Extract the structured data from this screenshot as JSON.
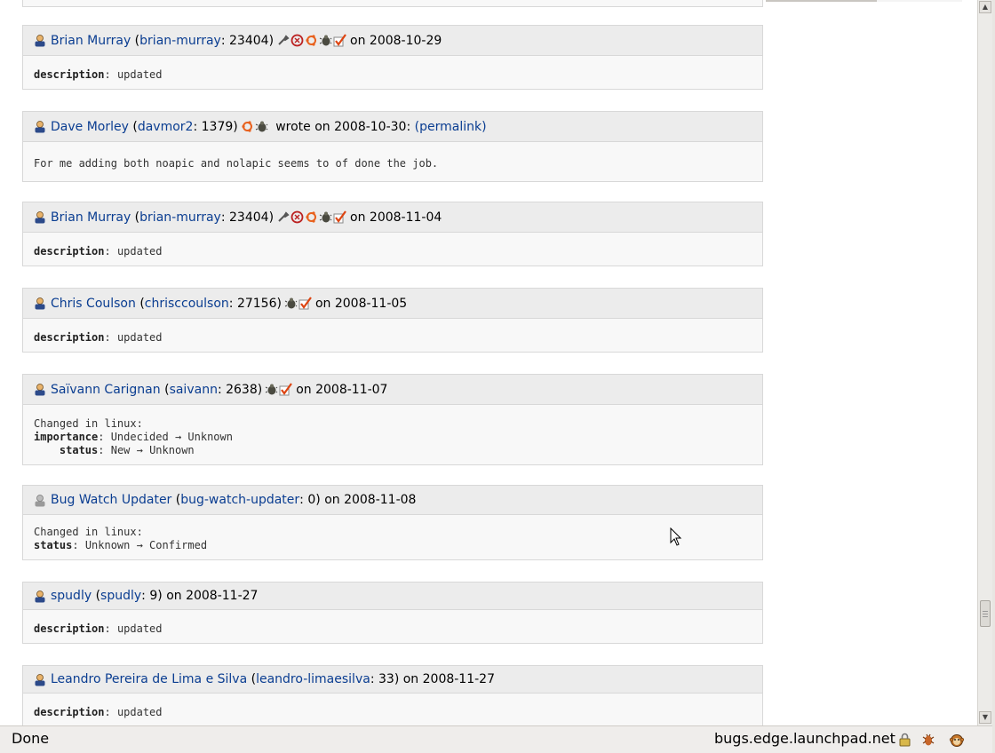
{
  "entries": [
    {
      "kind": "activity",
      "person": "Brian Murray",
      "username": "brian-murray",
      "karma": "23404",
      "badges": [
        "wrench",
        "ubuntu-red",
        "ubuntu-community",
        "bug",
        "check"
      ],
      "suffix": "on 2008-10-29",
      "body_lines": [
        {
          "key": "description",
          "value": "updated"
        }
      ]
    },
    {
      "kind": "comment",
      "person": "Dave Morley",
      "username": "davmor2",
      "karma": "1379",
      "badges": [
        "ubuntu-community",
        "bug"
      ],
      "suffix": "wrote on 2008-10-30:",
      "permalink": "(permalink)",
      "comment": "For me adding both noapic and nolapic seems to of done the job."
    },
    {
      "kind": "activity",
      "person": "Brian Murray",
      "username": "brian-murray",
      "karma": "23404",
      "badges": [
        "wrench",
        "ubuntu-red",
        "ubuntu-community",
        "bug",
        "check"
      ],
      "suffix": "on 2008-11-04",
      "body_lines": [
        {
          "key": "description",
          "value": "updated"
        }
      ]
    },
    {
      "kind": "activity",
      "person": "Chris Coulson",
      "username": "chrisccoulson",
      "karma": "27156",
      "badges": [
        "bug",
        "check"
      ],
      "suffix": "on 2008-11-05",
      "body_lines": [
        {
          "key": "description",
          "value": "updated"
        }
      ]
    },
    {
      "kind": "change",
      "person": "Saïvann Carignan",
      "username": "saivann",
      "karma": "2638",
      "badges": [
        "bug",
        "check"
      ],
      "suffix": "on 2008-11-07",
      "changed_in": "Changed in linux:",
      "body_lines": [
        {
          "key": "importance",
          "value": "Undecided → Unknown"
        },
        {
          "key": "status",
          "value": "New → Unknown",
          "indent": true
        }
      ]
    },
    {
      "kind": "change",
      "person": "Bug Watch Updater",
      "username": "bug-watch-updater",
      "karma": "0",
      "badges": [],
      "grey": true,
      "suffix": "on 2008-11-08",
      "changed_in": "Changed in linux:",
      "body_lines": [
        {
          "key": "status",
          "value": "Unknown → Confirmed"
        }
      ]
    },
    {
      "kind": "activity",
      "person": "spudly",
      "username": "spudly",
      "karma": "9",
      "badges": [],
      "suffix": "on 2008-11-27",
      "body_lines": [
        {
          "key": "description",
          "value": "updated"
        }
      ]
    },
    {
      "kind": "activity",
      "person": "Leandro Pereira de Lima e Silva",
      "username": "leandro-limaesilva",
      "karma": "33",
      "badges": [],
      "suffix": "on 2008-11-27",
      "body_lines": [
        {
          "key": "description",
          "value": "updated"
        }
      ]
    }
  ],
  "statusbar": {
    "text": "Done",
    "host": "bugs.edge.launchpad.net"
  },
  "colors": {
    "link": "#0a3d91",
    "header_bg": "#ececec",
    "body_bg": "#f8f8f8"
  }
}
